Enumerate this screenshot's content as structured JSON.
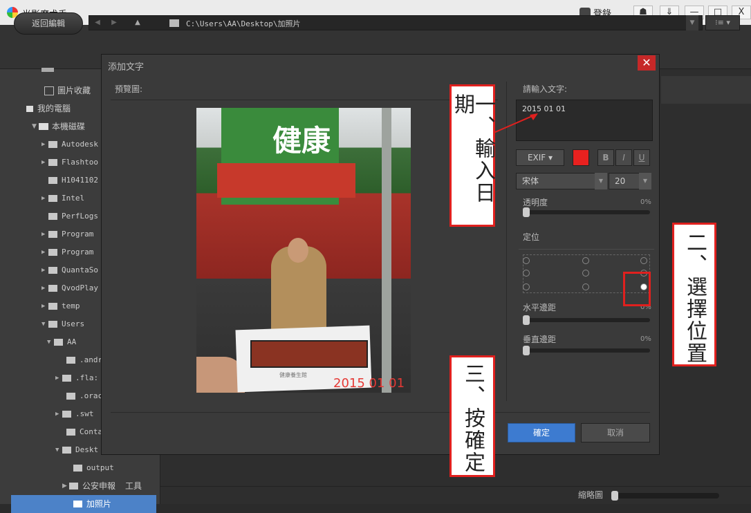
{
  "app": {
    "title": "光影魔术手",
    "login": "登錄",
    "min": "—",
    "max": "□",
    "close": "X",
    "pin": "☗",
    "menu": "⇓"
  },
  "toolbar": {
    "back_label": "返回編輯",
    "path": "C:\\Users\\AA\\Desktop\\加照片",
    "view_label": "⁝≡ ▾"
  },
  "sidebar": {
    "items": [
      {
        "label": "圖片收藏"
      },
      {
        "label": "我的電腦"
      },
      {
        "label": "本機磁碟"
      },
      {
        "label": "Autodesk"
      },
      {
        "label": "Flashtoo"
      },
      {
        "label": "H1041102"
      },
      {
        "label": "Intel"
      },
      {
        "label": "PerfLogs"
      },
      {
        "label": "Program"
      },
      {
        "label": "Program"
      },
      {
        "label": "QuantaSo"
      },
      {
        "label": "QvodPlay"
      },
      {
        "label": "temp"
      },
      {
        "label": "Users"
      },
      {
        "label": "AA"
      },
      {
        "label": ".andr"
      },
      {
        "label": ".fla:"
      },
      {
        "label": ".orac"
      },
      {
        "label": ".swt"
      },
      {
        "label": "Conta"
      },
      {
        "label": "Deskt"
      },
      {
        "label": "output"
      },
      {
        "label": "公安申報"
      },
      {
        "label": "加照片"
      }
    ],
    "extra_label": "工具"
  },
  "status": {
    "zoom_label": "縮略圖"
  },
  "dialog": {
    "title": "添加文字",
    "preview_label": "預覽圖:",
    "input_label": "請輸入文字:",
    "input_value": "2015 01 01",
    "exif_label": "EXIF ▾",
    "bold": "B",
    "italic": "I",
    "underline": "U",
    "font": "宋体",
    "size": "20",
    "opacity_label": "透明度",
    "opacity_value": "0%",
    "position_label": "定位",
    "hmargin_label": "水平邊距",
    "hmargin_value": "0%",
    "vmargin_label": "垂直邊距",
    "vmargin_value": "0%",
    "ok_label": "確定",
    "cancel_label": "取消",
    "close": "✕",
    "photo": {
      "sign_text": "健康",
      "card_caption": "健康養生館",
      "date_stamp": "2015 01 01"
    }
  },
  "annotations": {
    "step1": "一、輸入日期",
    "step2": "二、選擇位置",
    "step3": "三、按確定"
  },
  "colors": {
    "accent": "#3d7bd0",
    "annotation": "#e0201e",
    "swatch": "#e8211f"
  }
}
